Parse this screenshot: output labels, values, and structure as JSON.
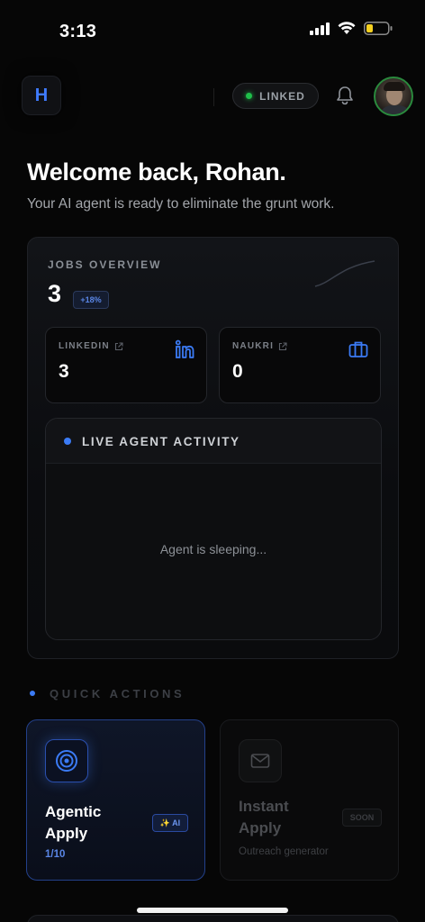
{
  "status_bar": {
    "time": "3:13"
  },
  "header": {
    "logo_letter": "H",
    "linked_label": "LINKED"
  },
  "welcome": {
    "title": "Welcome back, Rohan.",
    "subtitle": "Your AI agent is ready to eliminate the grunt work."
  },
  "jobs_overview": {
    "title": "JOBS OVERVIEW",
    "count": "3",
    "badge": "+18%",
    "sources": [
      {
        "label": "LINKEDIN",
        "value": "3",
        "icon": "linkedin-icon"
      },
      {
        "label": "NAUKRI",
        "value": "0",
        "icon": "briefcase-icon"
      }
    ],
    "activity": {
      "title": "LIVE AGENT ACTIVITY",
      "empty_text": "Agent is sleeping..."
    }
  },
  "quick_actions": {
    "title": "QUICK ACTIONS",
    "cards": [
      {
        "title_line1": "Agentic",
        "title_line2": "Apply",
        "tag": "✨ AI",
        "subtitle": "1/10",
        "icon": "target-icon"
      },
      {
        "title_line1": "Instant",
        "title_line2": "Apply",
        "tag": "SOON",
        "subtitle": "Outreach generator",
        "icon": "mail-icon"
      }
    ]
  },
  "colors": {
    "accent": "#3b7bf5",
    "linked_green": "#1fbf4a",
    "background": "#060606"
  }
}
